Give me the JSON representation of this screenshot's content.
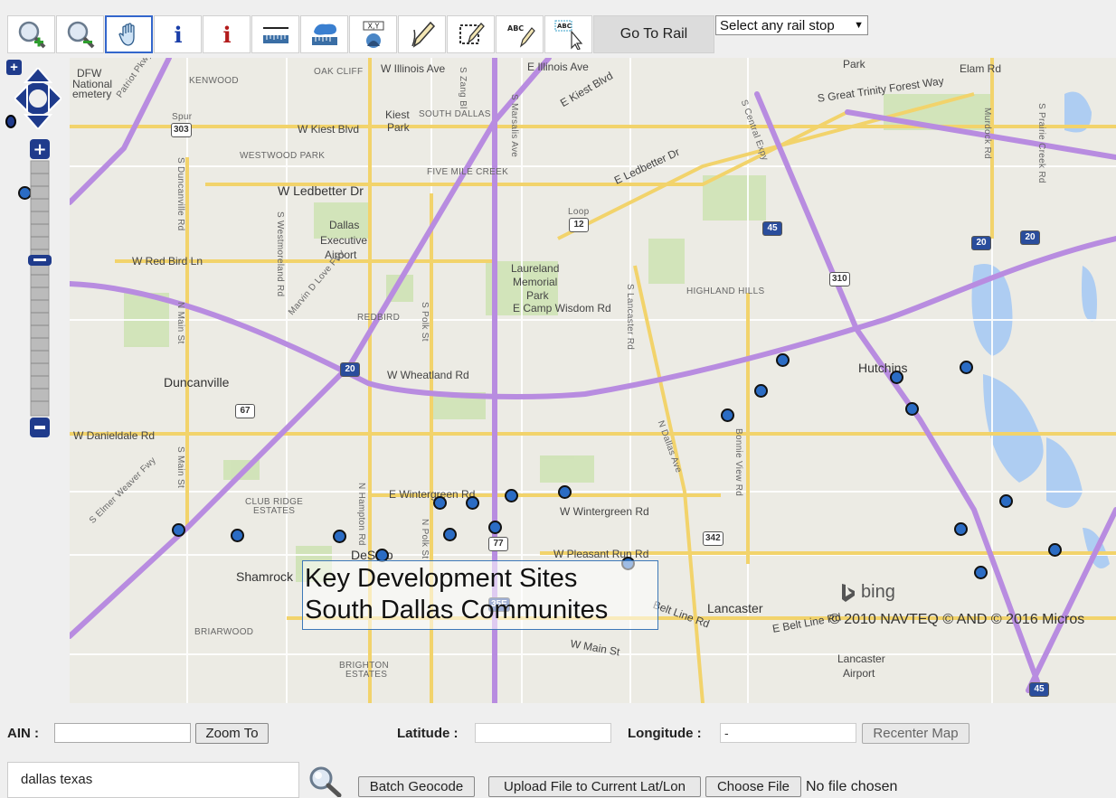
{
  "toolbar": {
    "tools": [
      {
        "name": "zoom-in-tool",
        "icon": "zoom-in-icon",
        "active": false
      },
      {
        "name": "zoom-out-tool",
        "icon": "zoom-out-icon",
        "active": false
      },
      {
        "name": "pan-tool",
        "icon": "hand-icon",
        "active": true
      },
      {
        "name": "identify-tool",
        "icon": "info-icon",
        "active": false
      },
      {
        "name": "identify-all-tool",
        "icon": "info-red-icon",
        "active": false
      },
      {
        "name": "measure-length-tool",
        "icon": "ruler-icon",
        "active": false
      },
      {
        "name": "measure-area-tool",
        "icon": "area-ruler-icon",
        "active": false
      },
      {
        "name": "xy-locate-tool",
        "icon": "xy-locate-icon",
        "active": false
      },
      {
        "name": "draw-tool",
        "icon": "pencil-icon",
        "active": false
      },
      {
        "name": "edit-shape-tool",
        "icon": "edit-shape-icon",
        "active": false
      },
      {
        "name": "add-text-tool",
        "icon": "text-pencil-icon",
        "active": false
      },
      {
        "name": "select-text-tool",
        "icon": "text-cursor-icon",
        "active": false
      }
    ],
    "go_to_rail": "Go To Rail",
    "rail_select": "Select any rail stop"
  },
  "map": {
    "caption_line1": "Key Development Sites",
    "caption_line2": "South Dallas Communites",
    "bing": "bing",
    "copyright": "© 2010 NAVTEQ © AND © 2016 Micros",
    "labels": {
      "dfw": "DFW",
      "national": "National",
      "cemetery": "emetery",
      "kenwood": "KENWOOD",
      "oak_cliff": "OAK CLIFF",
      "illinois_w": "W Illinois Ave",
      "illinois_e": "E Illinois Ave",
      "park": "Park",
      "elam": "Elam Rd",
      "kiest_w": "W Kiest Blvd",
      "kiest_park": "Kiest",
      "kiest_park2": "Park",
      "south_dallas": "SOUTH DALLAS",
      "kiest_e": "E Kiest Blvd",
      "great_trinity": "S Great Trinity Forest Way",
      "westwood": "WESTWOOD PARK",
      "five_mile": "FIVE MILE CREEK",
      "ledbetter_w": "W Ledbetter Dr",
      "ledbetter_e": "E Ledbetter Dr",
      "loop": "Loop",
      "airport1": "Dallas",
      "airport2": "Executive",
      "airport3": "Airport",
      "redbird_ln": "W Red Bird Ln",
      "laureland1": "Laureland",
      "laureland2": "Memorial",
      "laureland3": "Park",
      "camp_wisdom": "E Camp Wisdom Rd",
      "highland": "HIGHLAND HILLS",
      "redbird": "REDBIRD",
      "wheatland": "W Wheatland Rd",
      "duncanville": "Duncanville",
      "hutchins": "Hutchins",
      "danieldale": "W Danieldale Rd",
      "wintergreen_e": "E Wintergreen Rd",
      "wintergreen_w": "W Wintergreen Rd",
      "club_ridge1": "CLUB RIDGE",
      "club_ridge2": "ESTATES",
      "pleasant_run": "W Pleasant Run Rd",
      "desoto": "DeSoto",
      "shamrock": "Shamrock",
      "lancaster": "Lancaster",
      "belt_line": "E Belt Line Rd",
      "belt_line2": "Belt Line Rd",
      "main_st": "W Main St",
      "briarwood": "BRIARWOOD",
      "brighton1": "BRIGHTON",
      "brighton2": "ESTATES",
      "lancaster_ap1": "Lancaster",
      "lancaster_ap2": "Airport",
      "spur": "Spur",
      "spur_num": "303",
      "loop_num": "12",
      "i45": "45",
      "i20": "20",
      "i20b": "20",
      "i20c": "20",
      "us67": "67",
      "us77": "77",
      "sh310": "310",
      "sh342": "342",
      "i35e": "35E",
      "i45b": "45",
      "n_main": "N Main St",
      "s_main": "S Main St",
      "s_westmoreland": "S Westmoreland Rd",
      "s_polk": "S Polk St",
      "n_polk": "N Polk St",
      "n_hampton": "N Hampton Rd",
      "s_lancaster": "S Lancaster Rd",
      "n_dallas": "N Dallas Ave",
      "bonnie_view": "Bonnie View Rd",
      "s_central": "S Central Expy",
      "murdock": "Murdock Rd",
      "prairie_creek": "S Prairie Creek Rd",
      "duncanville_rd": "S Duncanville Rd",
      "marvin_love": "Marvin D Love Fwy",
      "patriot": "Patriot Pkwy",
      "s_marsalis": "S Marsalis Ave",
      "s_zang": "S Zang Bl",
      "elmer_weaver": "S Elmer Weaver Fwy"
    },
    "sites": [
      {
        "lon": -96.9211,
        "lat": 32.6398
      },
      {
        "lon": -96.9048,
        "lat": 32.6382
      },
      {
        "lon": -96.8767,
        "lat": 32.6381
      },
      {
        "lon": -96.8648,
        "lat": 32.6328
      },
      {
        "lon": -96.849,
        "lat": 32.6472
      },
      {
        "lon": -96.8463,
        "lat": 32.6385
      },
      {
        "lon": -96.8401,
        "lat": 32.6472
      },
      {
        "lon": -96.8337,
        "lat": 32.6406
      },
      {
        "lon": -96.8292,
        "lat": 32.6493
      },
      {
        "lon": -96.8146,
        "lat": 32.6501
      },
      {
        "lon": -96.797,
        "lat": 32.6306
      },
      {
        "lon": -96.7697,
        "lat": 32.6714
      },
      {
        "lon": -96.7604,
        "lat": 32.6782
      },
      {
        "lon": -96.7545,
        "lat": 32.6867
      },
      {
        "lon": -96.7229,
        "lat": 32.6818
      },
      {
        "lon": -96.7188,
        "lat": 32.6732
      },
      {
        "lon": -96.7038,
        "lat": 32.6847
      },
      {
        "lon": -96.7053,
        "lat": 32.6399
      },
      {
        "lon": -96.6927,
        "lat": 32.6477
      },
      {
        "lon": -96.6998,
        "lat": 32.628
      },
      {
        "lon": -96.6794,
        "lat": 32.6343
      }
    ]
  },
  "controls": {
    "ain_label": "AIN :",
    "ain_value": "",
    "zoom_to": "Zoom To",
    "lat_label": "Latitude :",
    "lat_value": "",
    "lon_label": "Longitude :",
    "lon_value": "-",
    "recenter": "Recenter Map",
    "search_value": "dallas texas",
    "batch_geocode": "Batch Geocode",
    "upload_file": "Upload File to Current Lat/Lon",
    "choose_file": "Choose File",
    "no_file": "No file chosen"
  }
}
